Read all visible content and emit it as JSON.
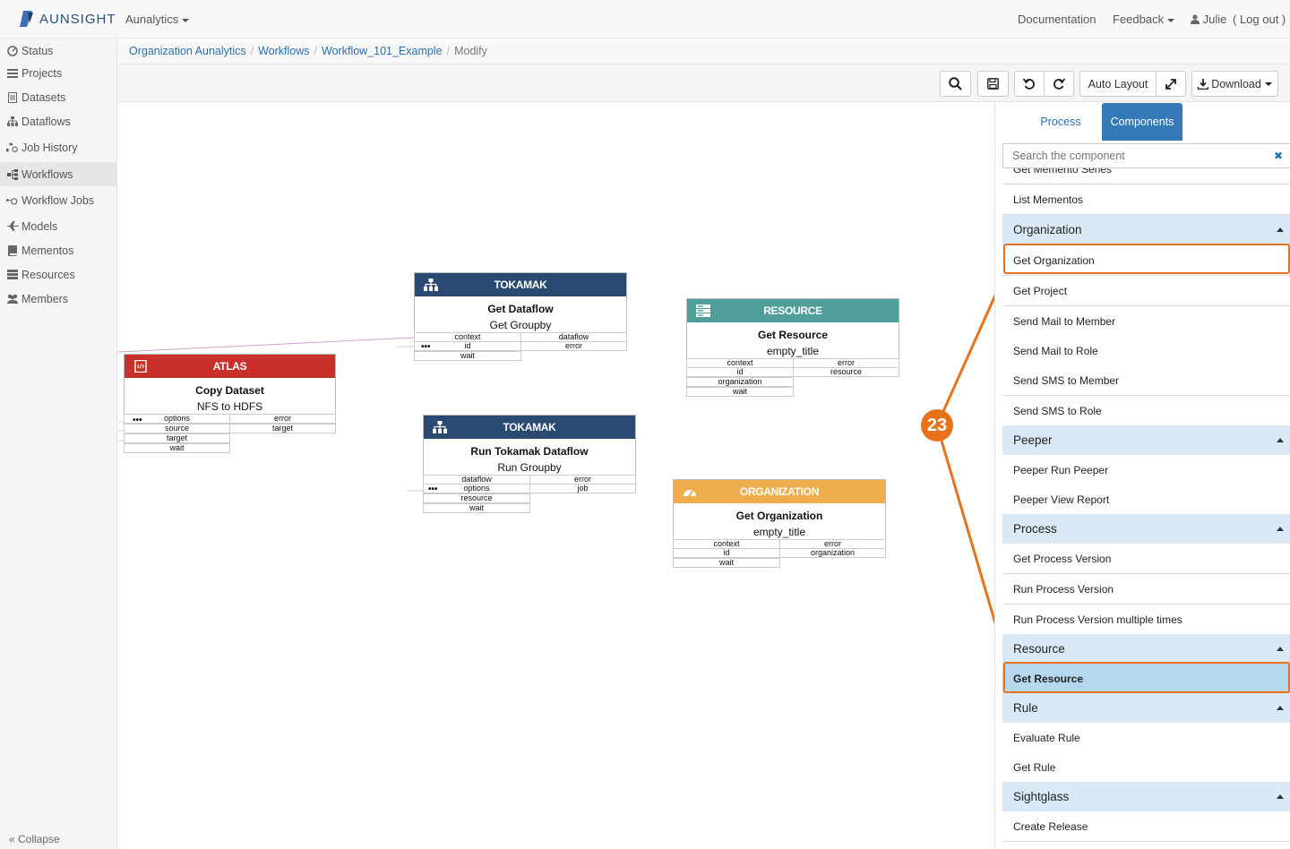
{
  "topnav": {
    "brand": "AUNSIGHT",
    "app": "Aunalytics",
    "documentation": "Documentation",
    "feedback": "Feedback",
    "user": "Julie",
    "logout": "( Log out )"
  },
  "sidebar": {
    "items": [
      {
        "label": "Status",
        "icon": "status-icon"
      },
      {
        "label": "Projects",
        "icon": "list-icon"
      },
      {
        "label": "Datasets",
        "icon": "file-icon"
      },
      {
        "label": "Dataflows",
        "icon": "sitemap-icon"
      },
      {
        "label": "Job History",
        "icon": "gears-icon"
      },
      {
        "label": "Workflows",
        "icon": "workflow-icon"
      },
      {
        "label": "Workflow Jobs",
        "icon": "workflow-jobs-icon"
      },
      {
        "label": "Models",
        "icon": "plane-icon"
      },
      {
        "label": "Mementos",
        "icon": "book-icon"
      },
      {
        "label": "Resources",
        "icon": "server-icon"
      },
      {
        "label": "Members",
        "icon": "users-icon"
      }
    ],
    "active": "Workflows",
    "collapse": "« Collapse"
  },
  "breadcrumb": {
    "items": [
      "Organization Aunalytics",
      "Workflows",
      "Workflow_101_Example"
    ],
    "current": "Modify"
  },
  "toolbar": {
    "auto_layout": "Auto Layout",
    "download": "Download"
  },
  "canvas": {
    "nodes": [
      {
        "id": "atlas",
        "type": "ATLAS",
        "color": "#c9302c",
        "icon": "file-code-icon",
        "title": "Copy Dataset",
        "subtitle": "NFS to HDFS",
        "inputs": [
          "options",
          "source",
          "target",
          "wait"
        ],
        "outputs": [
          "error",
          "target"
        ]
      },
      {
        "id": "tokamak1",
        "type": "TOKAMAK",
        "color": "#2b4a72",
        "icon": "sitemap-icon",
        "title": "Get Dataflow",
        "subtitle": "Get Groupby",
        "inputs": [
          "context",
          "id",
          "wait"
        ],
        "outputs": [
          "dataflow",
          "error"
        ]
      },
      {
        "id": "resource",
        "type": "RESOURCE",
        "color": "#4f9e9a",
        "icon": "server-icon",
        "title": "Get Resource",
        "subtitle": "empty_title",
        "inputs": [
          "context",
          "id",
          "organization",
          "wait"
        ],
        "outputs": [
          "error",
          "resource"
        ]
      },
      {
        "id": "tokamak2",
        "type": "TOKAMAK",
        "color": "#2b4a72",
        "icon": "sitemap-icon",
        "title": "Run Tokamak Dataflow",
        "subtitle": "Run Groupby",
        "inputs": [
          "dataflow",
          "options",
          "resource",
          "wait"
        ],
        "outputs": [
          "error",
          "job"
        ]
      },
      {
        "id": "organization",
        "type": "ORGANIZATION",
        "color": "#f0ad4e",
        "icon": "dashboard-icon",
        "title": "Get Organization",
        "subtitle": "empty_title",
        "inputs": [
          "context",
          "id",
          "wait"
        ],
        "outputs": [
          "error",
          "organization"
        ]
      }
    ]
  },
  "panel": {
    "tabs": {
      "process": "Process",
      "components": "Components"
    },
    "active_tab": "Components",
    "search_placeholder": "Search the component",
    "list": [
      {
        "kind": "item",
        "label": "Get Memento Series"
      },
      {
        "kind": "item",
        "label": "List Mementos"
      },
      {
        "kind": "group",
        "label": "Organization"
      },
      {
        "kind": "item",
        "label": "Get Organization",
        "highlight": true
      },
      {
        "kind": "item",
        "label": "Get Project"
      },
      {
        "kind": "item",
        "label": "Send Mail to Member"
      },
      {
        "kind": "item",
        "label": "Send Mail to Role"
      },
      {
        "kind": "item",
        "label": "Send SMS to Member"
      },
      {
        "kind": "item",
        "label": "Send SMS to Role"
      },
      {
        "kind": "group",
        "label": "Peeper"
      },
      {
        "kind": "item",
        "label": "Peeper Run Peeper"
      },
      {
        "kind": "item",
        "label": "Peeper View Report"
      },
      {
        "kind": "group",
        "label": "Process"
      },
      {
        "kind": "item",
        "label": "Get Process Version"
      },
      {
        "kind": "item",
        "label": "Run Process Version"
      },
      {
        "kind": "item",
        "label": "Run Process Version multiple times"
      },
      {
        "kind": "group",
        "label": "Resource"
      },
      {
        "kind": "item",
        "label": "Get Resource",
        "selected": true,
        "highlight": true
      },
      {
        "kind": "group",
        "label": "Rule"
      },
      {
        "kind": "item",
        "label": "Evaluate Rule"
      },
      {
        "kind": "item",
        "label": "Get Rule"
      },
      {
        "kind": "group",
        "label": "Sightglass"
      },
      {
        "kind": "item",
        "label": "Create Release"
      }
    ]
  },
  "callout": {
    "number": "23",
    "color": "#e8721c"
  }
}
